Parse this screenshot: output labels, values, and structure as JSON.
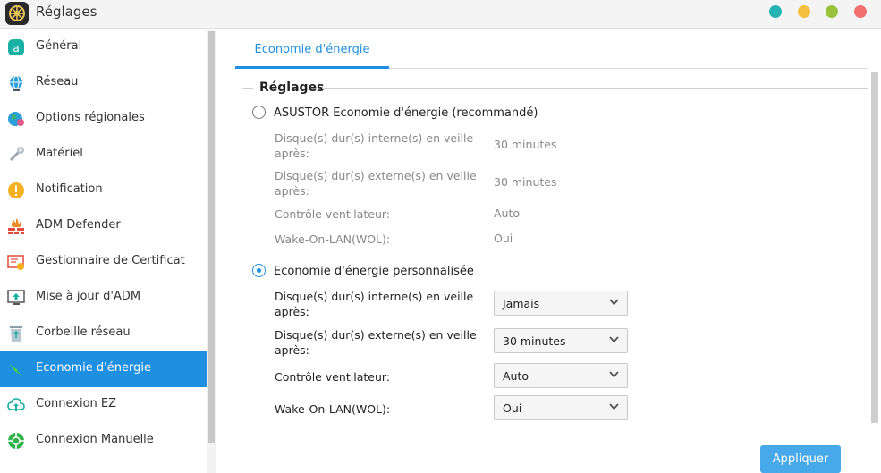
{
  "window": {
    "title": "Réglages",
    "controls": [
      {
        "name": "window-btn-teal",
        "color": "#26b3b3"
      },
      {
        "name": "window-btn-yellow",
        "color": "#f5c040"
      },
      {
        "name": "window-btn-green",
        "color": "#9ac23c"
      },
      {
        "name": "window-btn-red",
        "color": "#f07070"
      }
    ]
  },
  "sidebar": {
    "items": [
      {
        "label": "Général",
        "icon": "general-icon"
      },
      {
        "label": "Réseau",
        "icon": "network-globe-icon"
      },
      {
        "label": "Options régionales",
        "icon": "regional-globe-icon"
      },
      {
        "label": "Matériel",
        "icon": "hardware-wrench-icon"
      },
      {
        "label": "Notification",
        "icon": "notification-alert-icon"
      },
      {
        "label": "ADM Defender",
        "icon": "firewall-icon"
      },
      {
        "label": "Gestionnaire de Certificat",
        "icon": "certificate-icon"
      },
      {
        "label": "Mise à jour d'ADM",
        "icon": "update-icon"
      },
      {
        "label": "Corbeille réseau",
        "icon": "recycle-bin-icon"
      },
      {
        "label": "Economie d'énergie",
        "icon": "energy-bolt-icon",
        "active": true
      },
      {
        "label": "Connexion EZ",
        "icon": "cloud-connect-icon"
      },
      {
        "label": "Connexion Manuelle",
        "icon": "manual-connect-icon"
      }
    ]
  },
  "tab": {
    "label": "Economie d'énergie"
  },
  "settings": {
    "legend": "Réglages",
    "preset": {
      "label": "ASUSTOR Economie d'énergie (recommandé)",
      "selected": false,
      "rows": [
        {
          "label": "Disque(s) dur(s) interne(s) en veille après:",
          "value": "30 minutes"
        },
        {
          "label": "Disque(s) dur(s) externe(s) en veille après:",
          "value": "30 minutes"
        },
        {
          "label": "Contrôle ventilateur:",
          "value": "Auto"
        },
        {
          "label": "Wake-On-LAN(WOL):",
          "value": "Oui"
        }
      ]
    },
    "custom": {
      "label": "Economie d'énergie personnalisée",
      "selected": true,
      "rows": [
        {
          "label": "Disque(s) dur(s) interne(s) en veille après:",
          "value": "Jamais"
        },
        {
          "label": "Disque(s) dur(s) externe(s) en veille après:",
          "value": "30 minutes"
        },
        {
          "label": "Contrôle ventilateur:",
          "value": "Auto"
        },
        {
          "label": "Wake-On-LAN(WOL):",
          "value": "Oui"
        }
      ]
    }
  },
  "apply_label": "Appliquer",
  "colors": {
    "accent": "#1e8fe1",
    "apply": "#47a9ea"
  }
}
